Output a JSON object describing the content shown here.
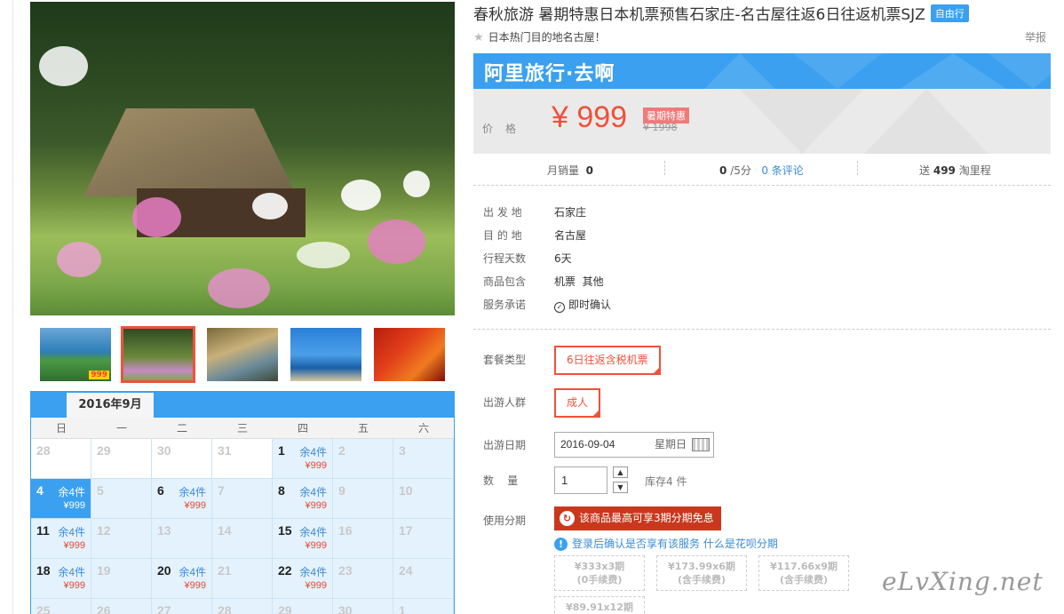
{
  "product": {
    "title": "春秋旅游 暑期特惠日本机票预售石家庄-名古屋往返6日往返机票SJZ",
    "badge": "自由行",
    "subtitle": "日本热门目的地名古屋！",
    "report": "举报"
  },
  "price_box": {
    "brand": "阿里旅行·去啊",
    "label": "价格",
    "price": "¥ 999",
    "promo_tag": "暑期特惠",
    "original_price": "¥ 1998"
  },
  "stats": {
    "monthly_sales_label": "月销量",
    "monthly_sales": "0",
    "rating": "0",
    "rating_suffix": "/5分",
    "reviews": "0 条评论",
    "points_prefix": "送",
    "points": "499",
    "points_suffix": "淘里程"
  },
  "info": [
    {
      "label": "出 发 地",
      "value": "石家庄"
    },
    {
      "label": "目 的 地",
      "value": "名古屋"
    },
    {
      "label": "行程天数",
      "value": "6天"
    },
    {
      "label": "商品包含",
      "value": "机票  其他"
    },
    {
      "label": "服务承诺",
      "value": "即时确认"
    }
  ],
  "options": {
    "package_label": "套餐类型",
    "package_value": "6日往返含税机票",
    "traveler_label": "出游人群",
    "traveler_value": "成人",
    "date_label": "出游日期",
    "date_value": "2016-09-04",
    "weekday": "星期日",
    "qty_label": "数    量",
    "qty_value": "1",
    "stock": "库存4 件",
    "install_label": "使用分期",
    "install_banner": "该商品最高可享3期分期免息",
    "notice": "登录后确认是否享有该服务",
    "notice_link": "什么是花呗分期"
  },
  "plans": [
    {
      "line1": "¥333x3期",
      "line2": "(0手续费)"
    },
    {
      "line1": "¥173.99x6期",
      "line2": "(含手续费)"
    },
    {
      "line1": "¥117.66x9期",
      "line2": "(含手续费)"
    },
    {
      "line1": "¥89.91x12期",
      "line2": ""
    }
  ],
  "thumbs": [
    "thumb-1",
    "thumb-2",
    "thumb-3",
    "thumb-4",
    "thumb-5"
  ],
  "thumb1_price": "999",
  "calendar": {
    "month": "2016年9月",
    "weekdays": [
      "日",
      "一",
      "二",
      "三",
      "四",
      "五",
      "六"
    ],
    "rows": [
      [
        {
          "d": "28"
        },
        {
          "d": "29"
        },
        {
          "d": "30"
        },
        {
          "d": "31"
        },
        {
          "d": "1",
          "s": "余4件",
          "p": "¥999"
        },
        {
          "d": "2"
        },
        {
          "d": "3"
        }
      ],
      [
        {
          "d": "4",
          "s": "余4件",
          "p": "¥999",
          "sel": true
        },
        {
          "d": "5"
        },
        {
          "d": "6",
          "s": "余4件",
          "p": "¥999"
        },
        {
          "d": "7"
        },
        {
          "d": "8",
          "s": "余4件",
          "p": "¥999"
        },
        {
          "d": "9"
        },
        {
          "d": "10"
        }
      ],
      [
        {
          "d": "11",
          "s": "余4件",
          "p": "¥999"
        },
        {
          "d": "12"
        },
        {
          "d": "13"
        },
        {
          "d": "14"
        },
        {
          "d": "15",
          "s": "余4件",
          "p": "¥999"
        },
        {
          "d": "16"
        },
        {
          "d": "17"
        }
      ],
      [
        {
          "d": "18",
          "s": "余4件",
          "p": "¥999"
        },
        {
          "d": "19"
        },
        {
          "d": "20",
          "s": "余4件",
          "p": "¥999"
        },
        {
          "d": "21"
        },
        {
          "d": "22",
          "s": "余4件",
          "p": "¥999"
        },
        {
          "d": "23"
        },
        {
          "d": "24"
        }
      ],
      [
        {
          "d": "25"
        },
        {
          "d": "26"
        },
        {
          "d": "27"
        },
        {
          "d": "28"
        },
        {
          "d": "29"
        },
        {
          "d": "30"
        },
        {
          "d": "1"
        }
      ]
    ]
  },
  "watermark": "eLvXing.net",
  "colors": {
    "accent": "#3aa0ef",
    "price": "#f0513a"
  }
}
